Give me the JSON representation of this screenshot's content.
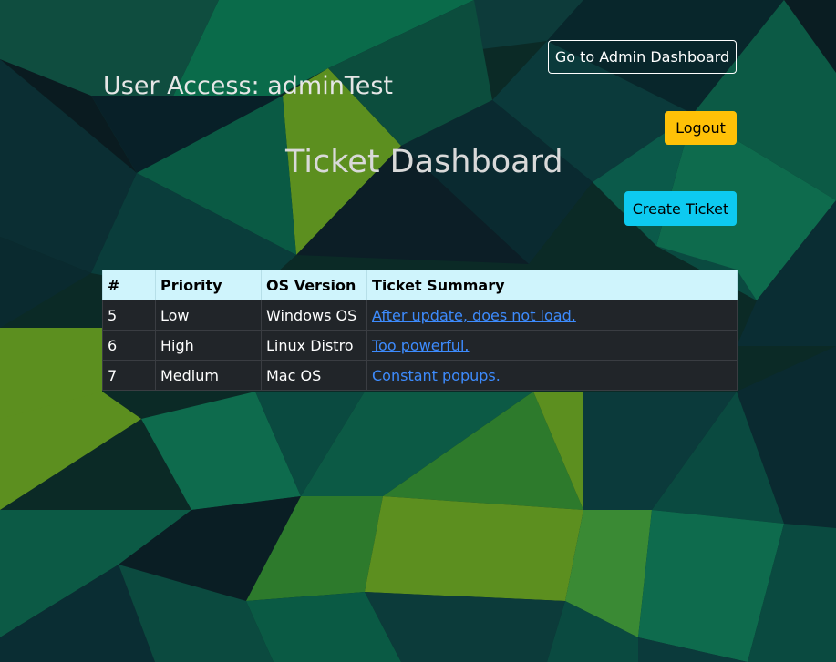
{
  "header": {
    "user_access_label": "User Access: adminTest",
    "admin_button_label": "Go to Admin Dashboard",
    "logout_button_label": "Logout"
  },
  "main": {
    "title": "Ticket Dashboard",
    "create_button_label": "Create Ticket"
  },
  "table": {
    "columns": [
      "#",
      "Priority",
      "OS Version",
      "Ticket Summary"
    ],
    "rows": [
      {
        "id": "5",
        "priority": "Low",
        "os": "Windows OS",
        "summary": "After update, does not load."
      },
      {
        "id": "6",
        "priority": "High",
        "os": "Linux Distro",
        "summary": "Too powerful."
      },
      {
        "id": "7",
        "priority": "Medium",
        "os": "Mac OS",
        "summary": "Constant popups."
      }
    ]
  },
  "colors": {
    "logout": "#ffc107",
    "create": "#0dcaf0",
    "table_header": "#cff4fc",
    "table_body": "#212529",
    "link": "#3d8bfd"
  }
}
